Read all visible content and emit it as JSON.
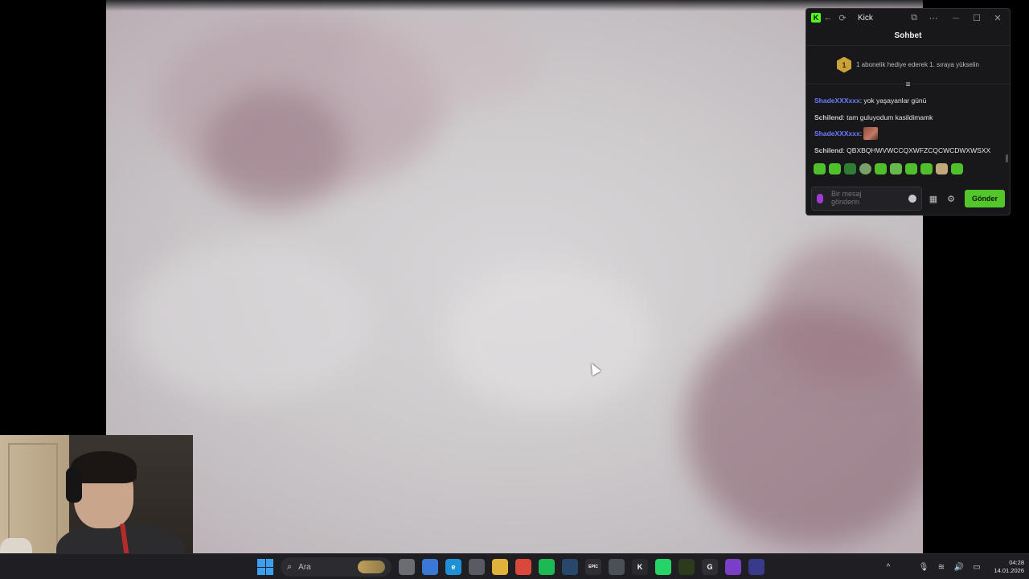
{
  "window": {
    "title": "Kick",
    "title_icons": [
      "kick-logo-icon",
      "back-arrow-icon",
      "refresh-icon",
      "popout-icon",
      "more-icon",
      "minimize-icon",
      "maximize-icon",
      "close-icon"
    ],
    "back_glyph": "←",
    "refresh_glyph": "⟳",
    "popout_glyph": "⧉",
    "more_glyph": "⋯",
    "minimize_glyph": "—",
    "maximize_glyph": "☐",
    "close_glyph": "✕",
    "logo_letter": "K"
  },
  "chat": {
    "header": "Sohbet",
    "gift_banner": {
      "badge_number": "1",
      "text": "1 abonelik hediye ederek 1. sıraya yükselin"
    },
    "pinned_glyph": "≡",
    "messages": [
      {
        "user": "ShadeXXXxxx",
        "user_color": "#6e7bff",
        "text": ": yok yaşayanlar günü"
      },
      {
        "user": "Schilend",
        "user_color": "#c9c9ce",
        "text": ": tam guluyodum kasildimamk"
      },
      {
        "user": "ShadeXXXxxx",
        "user_color": "#6e7bff",
        "text": ": "
      },
      {
        "user": "Schilend",
        "user_color": "#c9c9ce",
        "text": ": QBXBQHWVWCCQXWFZCQCWCDWXWSXX"
      }
    ],
    "input": {
      "placeholder": "Bir mesaj gönderin"
    },
    "send_label": "Gönder",
    "store_glyph": "▦",
    "settings_glyph": "⚙",
    "accent_color": "#53fc18"
  },
  "taskbar": {
    "search_placeholder": "Ara",
    "search_glyph": "⌕",
    "apps": [
      {
        "name": "task-view-icon",
        "color": "#6b6b72",
        "glyph": ""
      },
      {
        "name": "widgets-icon",
        "color": "#3a78d6",
        "glyph": ""
      },
      {
        "name": "edge-icon",
        "color": "#1f8fd6",
        "glyph": "e"
      },
      {
        "name": "store-icon",
        "color": "#5a5a62",
        "glyph": ""
      },
      {
        "name": "file-explorer-icon",
        "color": "#e0b23a",
        "glyph": ""
      },
      {
        "name": "chrome-icon",
        "color": "#d9483b",
        "glyph": ""
      },
      {
        "name": "spotify-icon",
        "color": "#1db954",
        "glyph": ""
      },
      {
        "name": "steam-icon",
        "color": "#27486b",
        "glyph": ""
      },
      {
        "name": "epic-icon",
        "color": "#2f2f33",
        "glyph": "EPIC"
      },
      {
        "name": "discord-icon",
        "color": "#4b4f58",
        "glyph": ""
      },
      {
        "name": "kick-icon",
        "color": "#2a2a2e",
        "glyph": "K"
      },
      {
        "name": "whatsapp-icon",
        "color": "#25d366",
        "glyph": ""
      },
      {
        "name": "nvidia-icon",
        "color": "#2d3a1c",
        "glyph": ""
      },
      {
        "name": "g-hub-icon",
        "color": "#2f2f33",
        "glyph": "G"
      },
      {
        "name": "visual-studio-icon",
        "color": "#7a3fc9",
        "glyph": ""
      },
      {
        "name": "obs-icon",
        "color": "#3a3a8a",
        "glyph": ""
      }
    ],
    "tray": {
      "chevron_glyph": "^",
      "clock_time": "04:28",
      "clock_date": "14.01.2026"
    }
  }
}
